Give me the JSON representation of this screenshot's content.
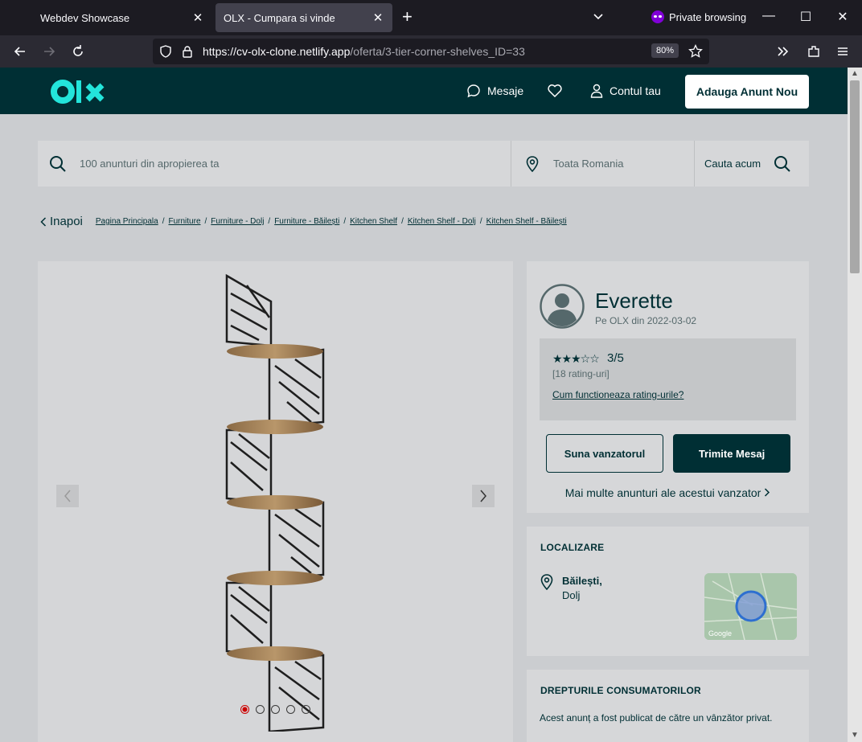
{
  "browser": {
    "tabs": [
      {
        "label": "Webdev Showcase",
        "active": false
      },
      {
        "label": "OLX - Cumpara si vinde",
        "active": true
      }
    ],
    "private_label": "Private browsing",
    "url_host": "https://cv-olx-clone.netlify.app",
    "url_path": "/oferta/3-tier-corner-shelves_ID=33",
    "zoom": "80%"
  },
  "header": {
    "logo_text": "olx",
    "messages_label": "Mesaje",
    "account_label": "Contul tau",
    "add_button_label": "Adauga Anunt Nou"
  },
  "search": {
    "query_placeholder": "100 anunturi din apropierea ta",
    "location_placeholder": "Toata Romania",
    "button_label": "Cauta acum"
  },
  "breadcrumb": {
    "back_label": "Inapoi",
    "items": [
      "Pagina Principala",
      "Furniture",
      "Furniture - Dolj",
      "Furniture - Băilești",
      "Kitchen Shelf",
      "Kitchen Shelf - Dolj",
      "Kitchen Shelf - Băilești"
    ]
  },
  "gallery": {
    "image_count": 5,
    "active_index": 0
  },
  "seller": {
    "name": "Everette",
    "since": "Pe OLX din 2022-03-02",
    "stars_filled": 3,
    "stars_total": 5,
    "score": "3/5",
    "rating_count": "[18 rating-uri]",
    "rating_help": "Cum functioneaza rating-urile?",
    "call_button": "Suna vanzatorul",
    "message_button": "Trimite Mesaj",
    "more_ads": "Mai multe anunturi ale acestui vanzator"
  },
  "location": {
    "title": "LOCALIZARE",
    "city": "Băilești,",
    "county": "Dolj",
    "map_attribution": "Google"
  },
  "consumer_rights": {
    "title": "DREPTURILE CONSUMATORILOR",
    "text": "Acest anunț a fost publicat de către un vânzător privat."
  },
  "colors": {
    "brand_dark": "#002f34",
    "brand_accent": "#23e5db"
  }
}
